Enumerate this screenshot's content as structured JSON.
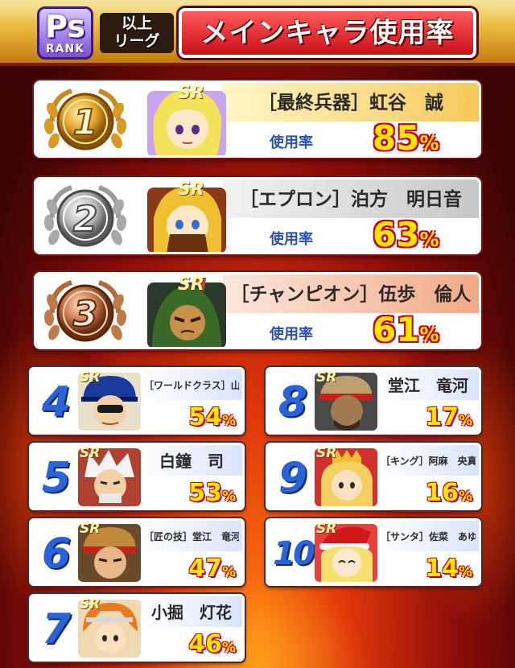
{
  "header": {
    "badge_letters": "Ps",
    "badge_rank": "RANK",
    "league_line1": "以上",
    "league_line2": "リーグ",
    "title": "メインキャラ使用率"
  },
  "usage_label": "使用率",
  "percent_unit": "%",
  "rarity_badge": "SR",
  "top_ranks": [
    {
      "rank": "1",
      "name": "［最終兵器］虹谷　誠",
      "value": "85",
      "usage_rate": 85,
      "medal": "gold-medal-icon"
    },
    {
      "rank": "2",
      "name": "［エプロン］泊方　明日音",
      "value": "63",
      "usage_rate": 63,
      "medal": "silver-medal-icon"
    },
    {
      "rank": "3",
      "name": "［チャンピオン］伍歩　倫人",
      "value": "61",
      "usage_rate": 61,
      "medal": "bronze-medal-icon"
    }
  ],
  "other_ranks": [
    {
      "rank": "4",
      "name": "［ワールドクラス］山口　賢",
      "value": "54",
      "usage_rate": 54
    },
    {
      "rank": "5",
      "name": "白鐘　司",
      "value": "53",
      "usage_rate": 53
    },
    {
      "rank": "6",
      "name": "［匠の技］堂江　竜河",
      "value": "47",
      "usage_rate": 47
    },
    {
      "rank": "7",
      "name": "小掘　灯花",
      "value": "46",
      "usage_rate": 46
    },
    {
      "rank": "8",
      "name": "堂江　竜河",
      "value": "17",
      "usage_rate": 17
    },
    {
      "rank": "9",
      "name": "［キング］阿麻　央真",
      "value": "16",
      "usage_rate": 16
    },
    {
      "rank": "10",
      "name": "［サンタ］佐菜　あゆみ",
      "value": "14",
      "usage_rate": 14
    }
  ],
  "colors": {
    "title_red": "#c80f1a",
    "percent_yellow": "#ffe600",
    "usage_blue": "#2a4fb8",
    "rank_blue": "#2a63d8"
  }
}
